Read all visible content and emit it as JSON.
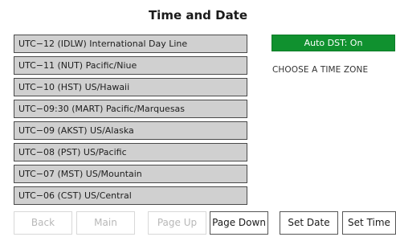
{
  "title": "Time and Date",
  "auto_dst_label": "Auto DST: On",
  "choose_label": "CHOOSE A TIME ZONE",
  "timezones": [
    "UTC−12 (IDLW) International Day Line",
    "UTC−11 (NUT) Pacific/Niue",
    "UTC−10 (HST) US/Hawaii",
    "UTC−09:30 (MART) Pacific/Marquesas",
    "UTC−09 (AKST) US/Alaska",
    "UTC−08 (PST) US/Pacific",
    "UTC−07 (MST) US/Mountain",
    "UTC−06 (CST) US/Central"
  ],
  "buttons": {
    "back": "Back",
    "main": "Main",
    "page_up": "Page Up",
    "page_down": "Page Down",
    "set_date": "Set Date",
    "set_time": "Set Time"
  },
  "colors": {
    "dst_green": "#10912f",
    "list_item_bg": "#d0d0d0",
    "disabled_text": "#b8b8b8"
  }
}
